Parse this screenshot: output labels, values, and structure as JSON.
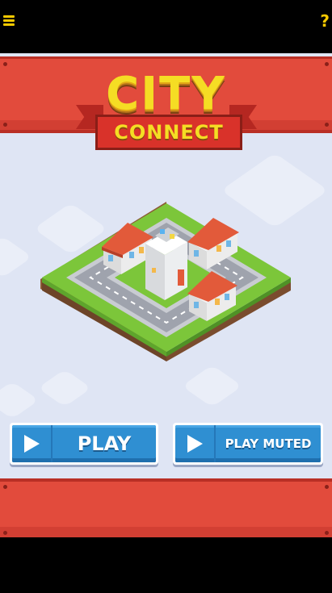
{
  "header": {
    "menu_icon": "hamburger-menu-icon",
    "help_label": "?"
  },
  "title": {
    "line1": "CITY",
    "line2": "CONNECT"
  },
  "buttons": {
    "play_label": "PLAY",
    "play_muted_label": "PLAY MUTED",
    "icon": "play-triangle-icon"
  },
  "colors": {
    "banner_red": "#e24b3c",
    "title_yellow": "#f5dd24",
    "button_blue": "#2f8fd2",
    "background": "#dfe5f4",
    "grass": "#7cc63a"
  }
}
